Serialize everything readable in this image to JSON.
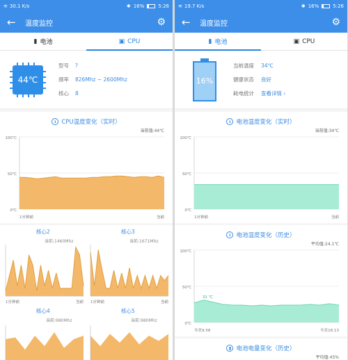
{
  "left": {
    "status": {
      "signal": "30.1 K/s",
      "battery": "16%",
      "time": "5:26"
    },
    "appbar_title": "温度监控",
    "tabs": [
      {
        "label": "电池"
      },
      {
        "label": "CPU"
      }
    ],
    "info": {
      "chip_temp": "44℃",
      "rows": [
        {
          "k": "型号",
          "v": "?"
        },
        {
          "k": "频率",
          "v": "826Mhz ~ 2600Mhz"
        },
        {
          "k": "核心",
          "v": "8"
        }
      ]
    },
    "chart": {
      "title": "CPU温度变化（实时）",
      "current": "当前值:44℃",
      "y_ticks": [
        "100℃",
        "50℃",
        "0℃"
      ],
      "x_start": "1分钟前",
      "x_end": "当前"
    },
    "cores": [
      {
        "title": "核心2",
        "freq": "当前:1460Mhz",
        "x_start": "1分钟前",
        "x_end": "当前"
      },
      {
        "title": "核心3",
        "freq": "当前:1671Mhz",
        "x_start": "1分钟前",
        "x_end": "当前"
      },
      {
        "title": "核心4",
        "freq": "当前:980Mhz"
      },
      {
        "title": "核心5",
        "freq": "当前:980Mhz"
      }
    ]
  },
  "right": {
    "status": {
      "signal": "19.7 K/s",
      "battery": "16%",
      "time": "5:26"
    },
    "appbar_title": "温度监控",
    "tabs": [
      {
        "label": "电池"
      },
      {
        "label": "CPU"
      }
    ],
    "info": {
      "battery_pct": "16%",
      "rows": [
        {
          "k": "当前温度",
          "v": "34℃"
        },
        {
          "k": "健康状态",
          "v": "良好"
        },
        {
          "k": "耗电统计",
          "v": "查看详情"
        }
      ]
    },
    "chart1": {
      "title": "电池温度变化（实时）",
      "current": "当前值:34℃",
      "y_ticks": [
        "100℃",
        "50℃",
        "0℃"
      ],
      "x_start": "1分钟前",
      "x_end": "当前"
    },
    "chart2": {
      "title": "电池温度变化（历史）",
      "current": "平均值:24.1℃",
      "y_ticks": [
        "100℃",
        "50℃",
        "0℃"
      ],
      "peak_label": "31 ℃",
      "x_start": "今天9:58",
      "x_end": "今天16:13"
    },
    "chart3": {
      "title": "电池电量变化（历史）",
      "current": "平均值:45%"
    }
  },
  "colors": {
    "primary": "#3c8ee8",
    "orange": "#f3b86a",
    "orange_line": "#e0a040",
    "green": "#a8ecd6",
    "green_line": "#6fd6b3"
  },
  "chart_data": [
    {
      "type": "area",
      "title": "CPU温度变化（实时）",
      "ylim": [
        0,
        100
      ],
      "values": [
        44,
        44,
        43,
        42,
        43,
        44,
        45,
        43,
        43,
        43,
        43,
        43,
        44,
        44,
        45,
        45,
        46,
        46,
        45,
        44,
        45,
        45,
        44,
        46,
        44
      ]
    },
    {
      "type": "area",
      "title": "电池温度变化（实时）",
      "ylim": [
        0,
        100
      ],
      "values": [
        34,
        34,
        34,
        34,
        34,
        34,
        34,
        34
      ]
    },
    {
      "type": "area",
      "title": "电池温度变化（历史）",
      "ylim": [
        0,
        100
      ],
      "values": [
        27,
        31,
        28,
        25,
        24,
        24,
        23,
        24,
        23,
        24,
        24,
        24,
        25,
        24,
        26,
        24
      ]
    },
    {
      "type": "area",
      "title": "核心2",
      "ylim": [
        0,
        100
      ],
      "values": [
        10,
        40,
        70,
        20,
        60,
        15,
        80,
        60,
        10,
        60,
        20,
        50,
        15,
        45,
        15,
        15,
        15,
        15,
        95,
        80,
        20
      ]
    },
    {
      "type": "area",
      "title": "核心3",
      "ylim": [
        0,
        100
      ],
      "values": [
        85,
        20,
        90,
        50,
        15,
        15,
        50,
        15,
        45,
        15,
        55,
        15,
        40,
        15,
        40,
        15,
        40,
        15,
        40,
        30,
        40
      ]
    }
  ]
}
